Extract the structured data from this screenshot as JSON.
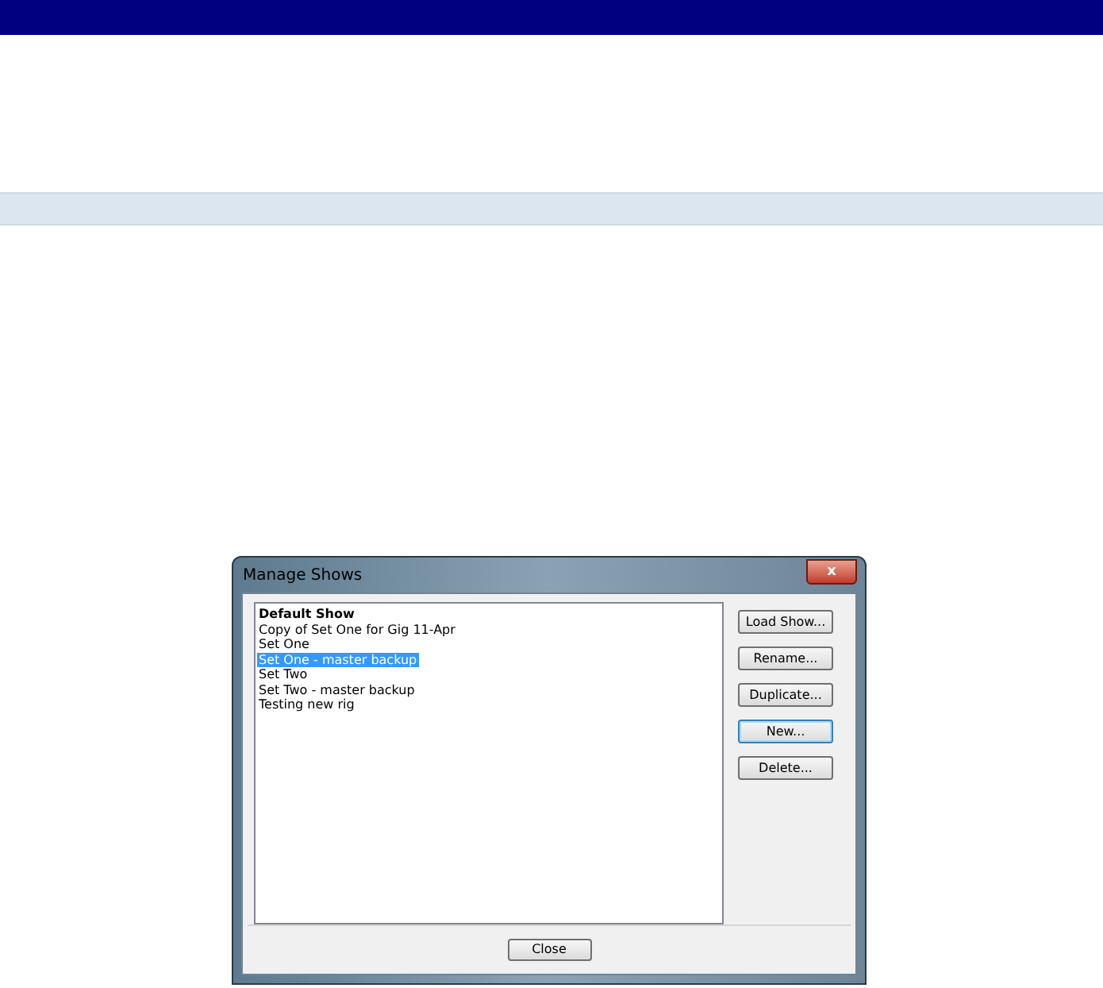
{
  "dialog": {
    "title": "Manage Shows",
    "close_icon": "x",
    "shows": [
      {
        "name": "Default Show",
        "is_default": true,
        "selected": false
      },
      {
        "name": "Copy of Set One for Gig 11-Apr",
        "is_default": false,
        "selected": false
      },
      {
        "name": "Set One",
        "is_default": false,
        "selected": false
      },
      {
        "name": "Set One - master backup",
        "is_default": false,
        "selected": true
      },
      {
        "name": "Set Two",
        "is_default": false,
        "selected": false
      },
      {
        "name": "Set Two - master backup",
        "is_default": false,
        "selected": false
      },
      {
        "name": "Testing new rig",
        "is_default": false,
        "selected": false
      }
    ],
    "buttons": [
      {
        "label": "Load Show...",
        "focused": false
      },
      {
        "label": "Rename...",
        "focused": false
      },
      {
        "label": "Duplicate...",
        "focused": false
      },
      {
        "label": "New...",
        "focused": true
      },
      {
        "label": "Delete...",
        "focused": false
      }
    ],
    "footer_button": "Close"
  }
}
